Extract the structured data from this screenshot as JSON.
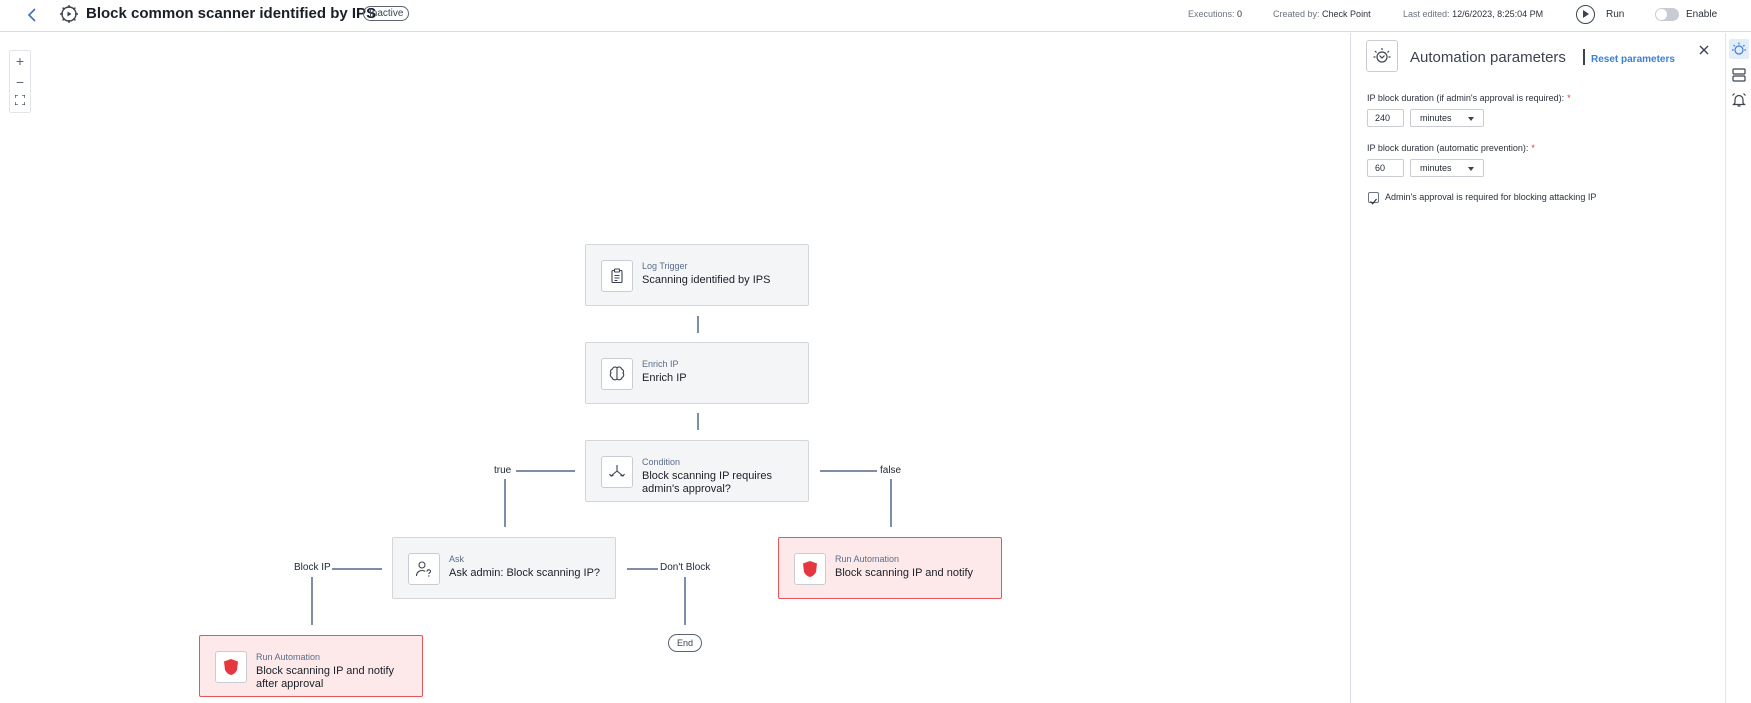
{
  "header": {
    "title": "Block common scanner identified by IPS",
    "status_badge": "Inactive",
    "executions_label": "Executions:",
    "executions_value": "0",
    "created_label": "Created by:",
    "created_value": "Check Point",
    "edited_label": "Last edited:",
    "edited_value": "12/6/2023, 8:25:04 PM",
    "run_label": "Run",
    "enable_label": "Enable",
    "enabled": false
  },
  "zoom": {
    "in": "+",
    "out": "−",
    "fit": "⛶"
  },
  "flow": {
    "nodes": [
      {
        "id": "log-trigger",
        "type": "Log Trigger",
        "name": "Scanning identified by IPS",
        "icon": "clipboard-icon"
      },
      {
        "id": "enrich-ip",
        "type": "Enrich IP",
        "name": "Enrich IP",
        "icon": "brain-icon"
      },
      {
        "id": "condition",
        "type": "Condition",
        "name": "Block scanning IP requires admin's approval?",
        "icon": "split-arrows-icon"
      },
      {
        "id": "ask",
        "type": "Ask",
        "name": "Ask admin: Block scanning IP?",
        "icon": "user-question-icon"
      },
      {
        "id": "run-automation-notify",
        "type": "Run Automation",
        "name": "Block scanning IP and notify",
        "icon": "shield-icon"
      },
      {
        "id": "run-automation-approval",
        "type": "Run Automation",
        "name": "Block scanning IP and notify after approval",
        "icon": "shield-icon"
      }
    ],
    "edge_labels": {
      "true": "true",
      "false": "false",
      "block_ip": "Block IP",
      "dont_block": "Don't Block"
    },
    "end_label": "End"
  },
  "panel": {
    "title": "Automation parameters",
    "reset_label": "Reset parameters",
    "fields": [
      {
        "label": "IP block duration (if admin's approval is required):",
        "required_mark": "*",
        "value": "240",
        "unit": "minutes"
      },
      {
        "label": "IP block duration (automatic prevention):",
        "required_mark": "*",
        "value": "60",
        "unit": "minutes"
      }
    ],
    "checkbox_label": "Admin's approval is required for blocking attacking IP",
    "checkbox_checked": true
  },
  "colors": {
    "accent": "#3d7fd6",
    "danger": "#e5555a",
    "danger_bg": "#fde9e9",
    "connector": "#7d8fa7"
  }
}
